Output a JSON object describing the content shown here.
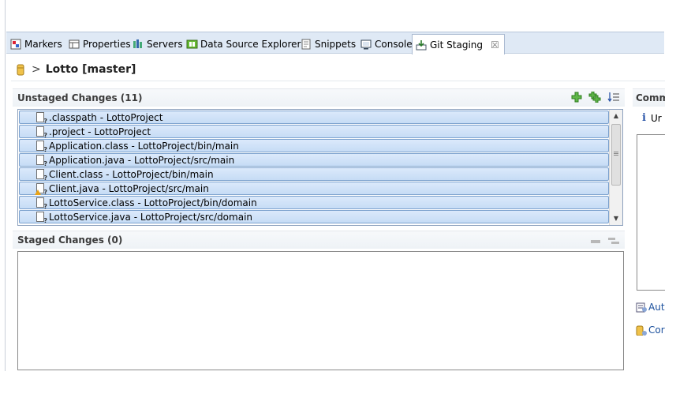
{
  "tabs": [
    {
      "label": "Markers",
      "icon": "markers-icon"
    },
    {
      "label": "Properties",
      "icon": "properties-icon"
    },
    {
      "label": "Servers",
      "icon": "servers-icon"
    },
    {
      "label": "Data Source Explorer",
      "icon": "data-source-icon"
    },
    {
      "label": "Snippets",
      "icon": "snippets-icon"
    },
    {
      "label": "Console",
      "icon": "console-icon"
    },
    {
      "label": "Git Staging",
      "icon": "git-staging-icon",
      "active": true,
      "close": "☒"
    }
  ],
  "breadcrumb": {
    "separator": ">",
    "title": "Lotto [master]"
  },
  "unstaged": {
    "header": "Unstaged Changes (11)",
    "tools": [
      "add-icon",
      "add-all-icon",
      "sort-icon"
    ],
    "items": [
      {
        "label": ".classpath - LottoProject",
        "icon": "modified-file-icon"
      },
      {
        "label": ".project - LottoProject",
        "icon": "modified-file-icon"
      },
      {
        "label": "Application.class - LottoProject/bin/main",
        "icon": "untracked-file-icon"
      },
      {
        "label": "Application.java - LottoProject/src/main",
        "icon": "untracked-file-icon"
      },
      {
        "label": "Client.class - LottoProject/bin/main",
        "icon": "untracked-file-icon"
      },
      {
        "label": "Client.java - LottoProject/src/main",
        "icon": "untracked-warning-file-icon"
      },
      {
        "label": "LottoService.class - LottoProject/bin/domain",
        "icon": "untracked-file-icon"
      },
      {
        "label": "LottoService.java - LottoProject/src/domain",
        "icon": "untracked-file-icon"
      }
    ]
  },
  "staged": {
    "header": "Staged Changes (0)",
    "tools": [
      "remove-icon",
      "remove-all-icon"
    ]
  },
  "commit": {
    "header": "Comm",
    "info_text": "Ur",
    "author_text": "Aut",
    "committer_text": "Cor"
  },
  "colors": {
    "tabbar_bg": "#dfe9f5",
    "row_bg": "#c6dcf5",
    "row_border": "#7da2ce",
    "add_green": "#3f9a2c"
  }
}
